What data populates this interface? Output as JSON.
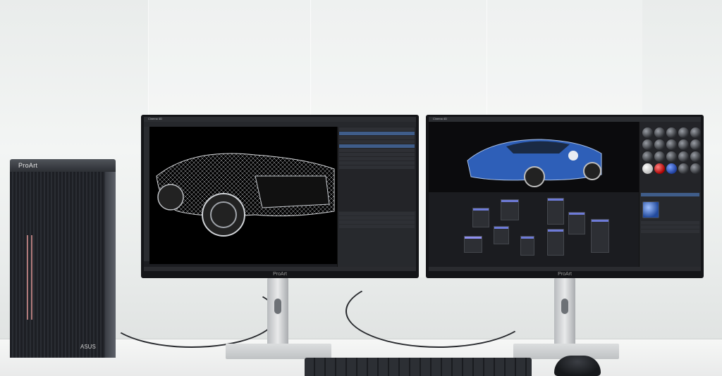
{
  "tower": {
    "logo": "ProArt",
    "brand": "ASUS"
  },
  "monitor_left": {
    "brand": "ProArt",
    "app_title": "Cinema 4D",
    "subject": "wireframe sports car"
  },
  "monitor_right": {
    "brand": "ProArt",
    "app_title": "Cinema 4D",
    "subject": "rendered blue sports car with node editor"
  },
  "colors": {
    "tower_stripe": "#b07a7a",
    "node_header": "#6e7bd8",
    "car_blue": "#2e5fb8"
  }
}
